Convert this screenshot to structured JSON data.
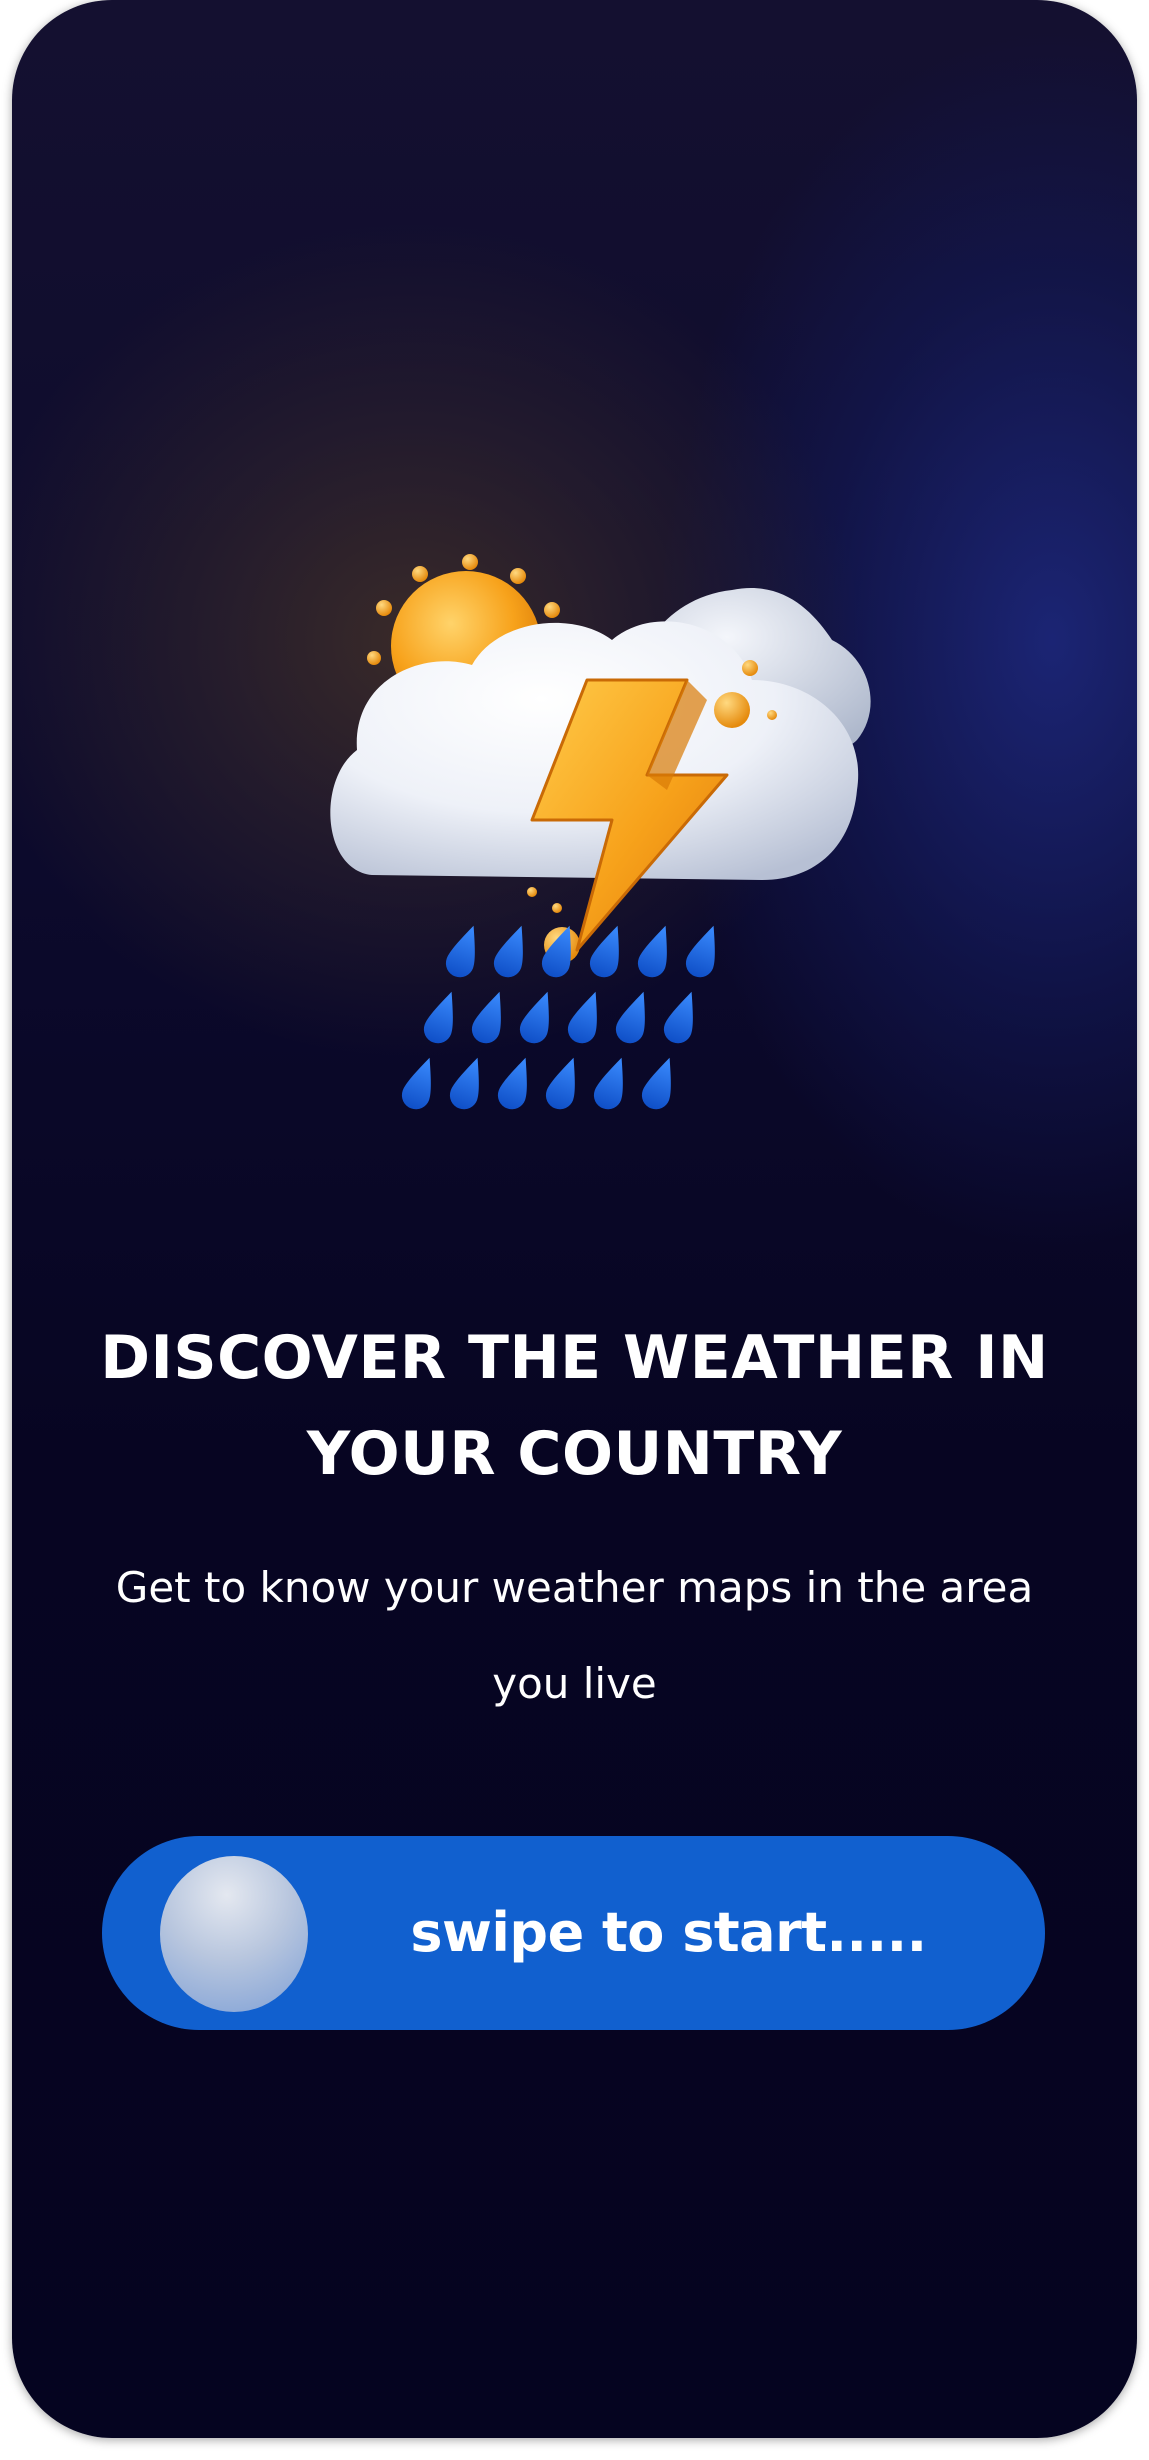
{
  "onboarding": {
    "title": "DISCOVER THE WEATHER IN YOUR COUNTRY",
    "subtitle": "Get to know your weather maps in the area you live",
    "illustration_icon": "thunderstorm-rain-sun-icon"
  },
  "swipe": {
    "label": "swipe to start....."
  },
  "colors": {
    "swipe_track": "#1160cf",
    "background_dark": "#070522",
    "title_text": "#ffffff",
    "lightning": "#f5a21a",
    "raindrop": "#1a6fe8"
  }
}
